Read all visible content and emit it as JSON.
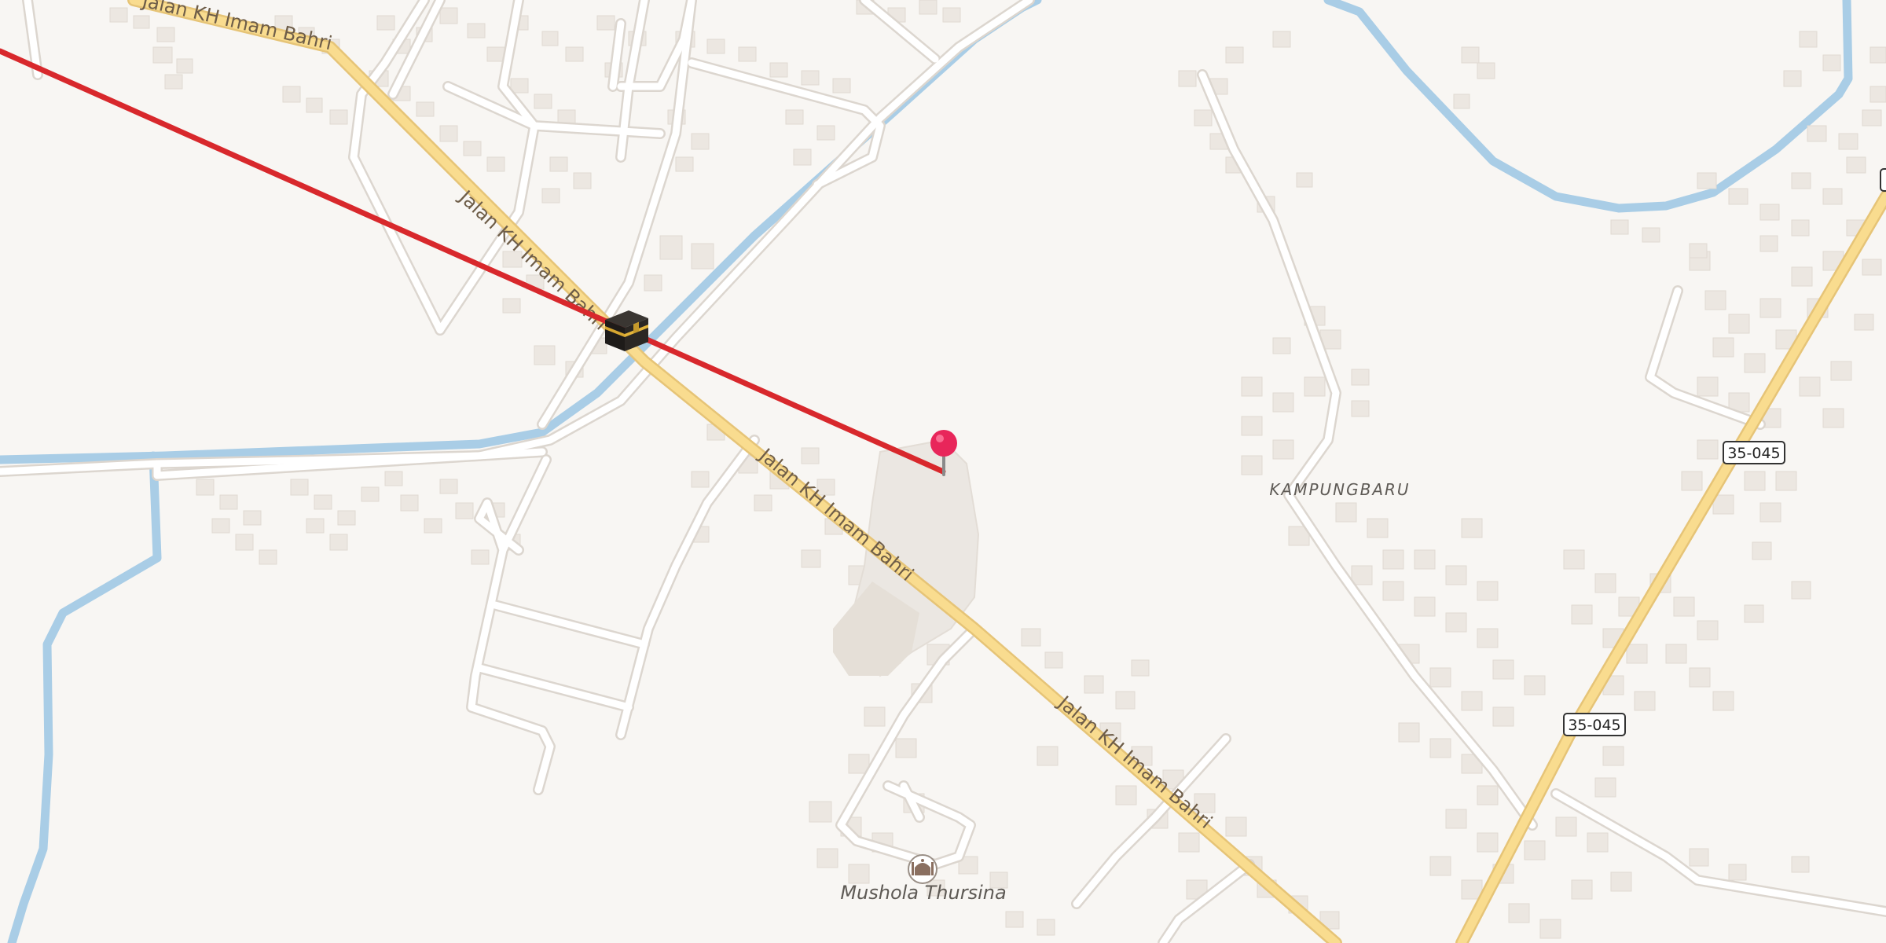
{
  "map": {
    "roads": {
      "main_road_name": "Jalan KH Imam Bahri",
      "route_shield": "35-045"
    },
    "places": {
      "village": "KAMPUNGBARU",
      "poi_name": "Mushola Thursina"
    },
    "markers": {
      "qibla_icon": "kaaba-icon",
      "pin_icon": "map-pin-icon"
    },
    "colors": {
      "background": "#f8f6f3",
      "primary_road": "#f9dc8f",
      "water": "#a9cde6",
      "route_line": "#d8282c",
      "pin": "#e8265a",
      "building": "#ece7e1"
    }
  }
}
